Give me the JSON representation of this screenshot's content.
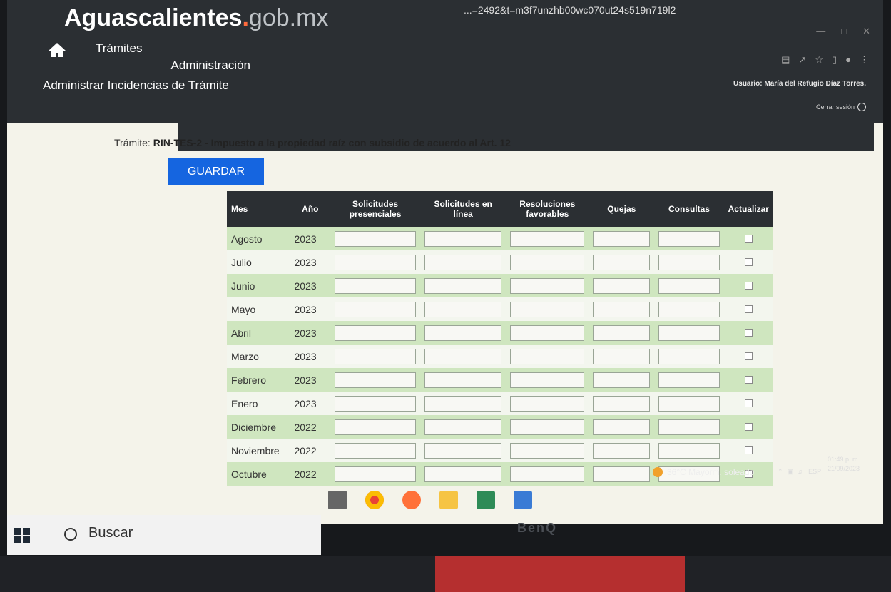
{
  "browser": {
    "url_fragment": "...=2492&t=m3f7unzhb00wc070ut24s519n719l2"
  },
  "site": {
    "logo_main": "Aguascalientes",
    "logo_dot": ".",
    "logo_domain": "gob.mx"
  },
  "nav": {
    "items": [
      {
        "label": "Trámites"
      },
      {
        "label": "Administración"
      }
    ]
  },
  "page": {
    "title": "Administrar Incidencias de Trámite"
  },
  "user": {
    "label": "Usuario: María del Refugio Díaz Torres.",
    "logout": "Cerrar sesión"
  },
  "tramite": {
    "label": "Trámite:",
    "code": "RIN-TES-2",
    "description": " - Impuesto a la propiedad raíz con subsidio de acuerdo al Art. 12"
  },
  "actions": {
    "save_label": "GUARDAR"
  },
  "table": {
    "headers": [
      "Mes",
      "Año",
      "Solicitudes presenciales",
      "Solicitudes en línea",
      "Resoluciones favorables",
      "Quejas",
      "Consultas",
      "Actualizar"
    ],
    "rows": [
      {
        "mes": "Agosto",
        "anio": "2023"
      },
      {
        "mes": "Julio",
        "anio": "2023"
      },
      {
        "mes": "Junio",
        "anio": "2023"
      },
      {
        "mes": "Mayo",
        "anio": "2023"
      },
      {
        "mes": "Abril",
        "anio": "2023"
      },
      {
        "mes": "Marzo",
        "anio": "2023"
      },
      {
        "mes": "Febrero",
        "anio": "2023"
      },
      {
        "mes": "Enero",
        "anio": "2023"
      },
      {
        "mes": "Diciembre",
        "anio": "2022"
      },
      {
        "mes": "Noviembre",
        "anio": "2022"
      },
      {
        "mes": "Octubre",
        "anio": "2022"
      }
    ]
  },
  "taskbar": {
    "weather": "36°C Mayorm. soleado",
    "lang": "ESP",
    "time": "01:49 p. m.",
    "date": "21/09/2023",
    "search_placeholder": "Buscar"
  },
  "monitor": {
    "brand": "BenQ"
  }
}
